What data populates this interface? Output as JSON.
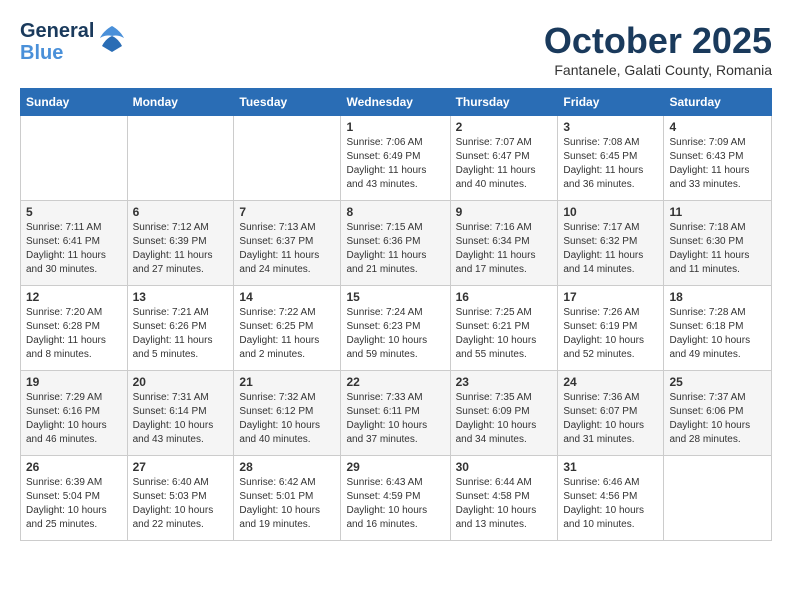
{
  "header": {
    "logo_general": "General",
    "logo_blue": "Blue",
    "month": "October 2025",
    "location": "Fantanele, Galati County, Romania"
  },
  "weekdays": [
    "Sunday",
    "Monday",
    "Tuesday",
    "Wednesday",
    "Thursday",
    "Friday",
    "Saturday"
  ],
  "weeks": [
    [
      {
        "day": "",
        "info": ""
      },
      {
        "day": "",
        "info": ""
      },
      {
        "day": "",
        "info": ""
      },
      {
        "day": "1",
        "info": "Sunrise: 7:06 AM\nSunset: 6:49 PM\nDaylight: 11 hours and 43 minutes."
      },
      {
        "day": "2",
        "info": "Sunrise: 7:07 AM\nSunset: 6:47 PM\nDaylight: 11 hours and 40 minutes."
      },
      {
        "day": "3",
        "info": "Sunrise: 7:08 AM\nSunset: 6:45 PM\nDaylight: 11 hours and 36 minutes."
      },
      {
        "day": "4",
        "info": "Sunrise: 7:09 AM\nSunset: 6:43 PM\nDaylight: 11 hours and 33 minutes."
      }
    ],
    [
      {
        "day": "5",
        "info": "Sunrise: 7:11 AM\nSunset: 6:41 PM\nDaylight: 11 hours and 30 minutes."
      },
      {
        "day": "6",
        "info": "Sunrise: 7:12 AM\nSunset: 6:39 PM\nDaylight: 11 hours and 27 minutes."
      },
      {
        "day": "7",
        "info": "Sunrise: 7:13 AM\nSunset: 6:37 PM\nDaylight: 11 hours and 24 minutes."
      },
      {
        "day": "8",
        "info": "Sunrise: 7:15 AM\nSunset: 6:36 PM\nDaylight: 11 hours and 21 minutes."
      },
      {
        "day": "9",
        "info": "Sunrise: 7:16 AM\nSunset: 6:34 PM\nDaylight: 11 hours and 17 minutes."
      },
      {
        "day": "10",
        "info": "Sunrise: 7:17 AM\nSunset: 6:32 PM\nDaylight: 11 hours and 14 minutes."
      },
      {
        "day": "11",
        "info": "Sunrise: 7:18 AM\nSunset: 6:30 PM\nDaylight: 11 hours and 11 minutes."
      }
    ],
    [
      {
        "day": "12",
        "info": "Sunrise: 7:20 AM\nSunset: 6:28 PM\nDaylight: 11 hours and 8 minutes."
      },
      {
        "day": "13",
        "info": "Sunrise: 7:21 AM\nSunset: 6:26 PM\nDaylight: 11 hours and 5 minutes."
      },
      {
        "day": "14",
        "info": "Sunrise: 7:22 AM\nSunset: 6:25 PM\nDaylight: 11 hours and 2 minutes."
      },
      {
        "day": "15",
        "info": "Sunrise: 7:24 AM\nSunset: 6:23 PM\nDaylight: 10 hours and 59 minutes."
      },
      {
        "day": "16",
        "info": "Sunrise: 7:25 AM\nSunset: 6:21 PM\nDaylight: 10 hours and 55 minutes."
      },
      {
        "day": "17",
        "info": "Sunrise: 7:26 AM\nSunset: 6:19 PM\nDaylight: 10 hours and 52 minutes."
      },
      {
        "day": "18",
        "info": "Sunrise: 7:28 AM\nSunset: 6:18 PM\nDaylight: 10 hours and 49 minutes."
      }
    ],
    [
      {
        "day": "19",
        "info": "Sunrise: 7:29 AM\nSunset: 6:16 PM\nDaylight: 10 hours and 46 minutes."
      },
      {
        "day": "20",
        "info": "Sunrise: 7:31 AM\nSunset: 6:14 PM\nDaylight: 10 hours and 43 minutes."
      },
      {
        "day": "21",
        "info": "Sunrise: 7:32 AM\nSunset: 6:12 PM\nDaylight: 10 hours and 40 minutes."
      },
      {
        "day": "22",
        "info": "Sunrise: 7:33 AM\nSunset: 6:11 PM\nDaylight: 10 hours and 37 minutes."
      },
      {
        "day": "23",
        "info": "Sunrise: 7:35 AM\nSunset: 6:09 PM\nDaylight: 10 hours and 34 minutes."
      },
      {
        "day": "24",
        "info": "Sunrise: 7:36 AM\nSunset: 6:07 PM\nDaylight: 10 hours and 31 minutes."
      },
      {
        "day": "25",
        "info": "Sunrise: 7:37 AM\nSunset: 6:06 PM\nDaylight: 10 hours and 28 minutes."
      }
    ],
    [
      {
        "day": "26",
        "info": "Sunrise: 6:39 AM\nSunset: 5:04 PM\nDaylight: 10 hours and 25 minutes."
      },
      {
        "day": "27",
        "info": "Sunrise: 6:40 AM\nSunset: 5:03 PM\nDaylight: 10 hours and 22 minutes."
      },
      {
        "day": "28",
        "info": "Sunrise: 6:42 AM\nSunset: 5:01 PM\nDaylight: 10 hours and 19 minutes."
      },
      {
        "day": "29",
        "info": "Sunrise: 6:43 AM\nSunset: 4:59 PM\nDaylight: 10 hours and 16 minutes."
      },
      {
        "day": "30",
        "info": "Sunrise: 6:44 AM\nSunset: 4:58 PM\nDaylight: 10 hours and 13 minutes."
      },
      {
        "day": "31",
        "info": "Sunrise: 6:46 AM\nSunset: 4:56 PM\nDaylight: 10 hours and 10 minutes."
      },
      {
        "day": "",
        "info": ""
      }
    ]
  ]
}
